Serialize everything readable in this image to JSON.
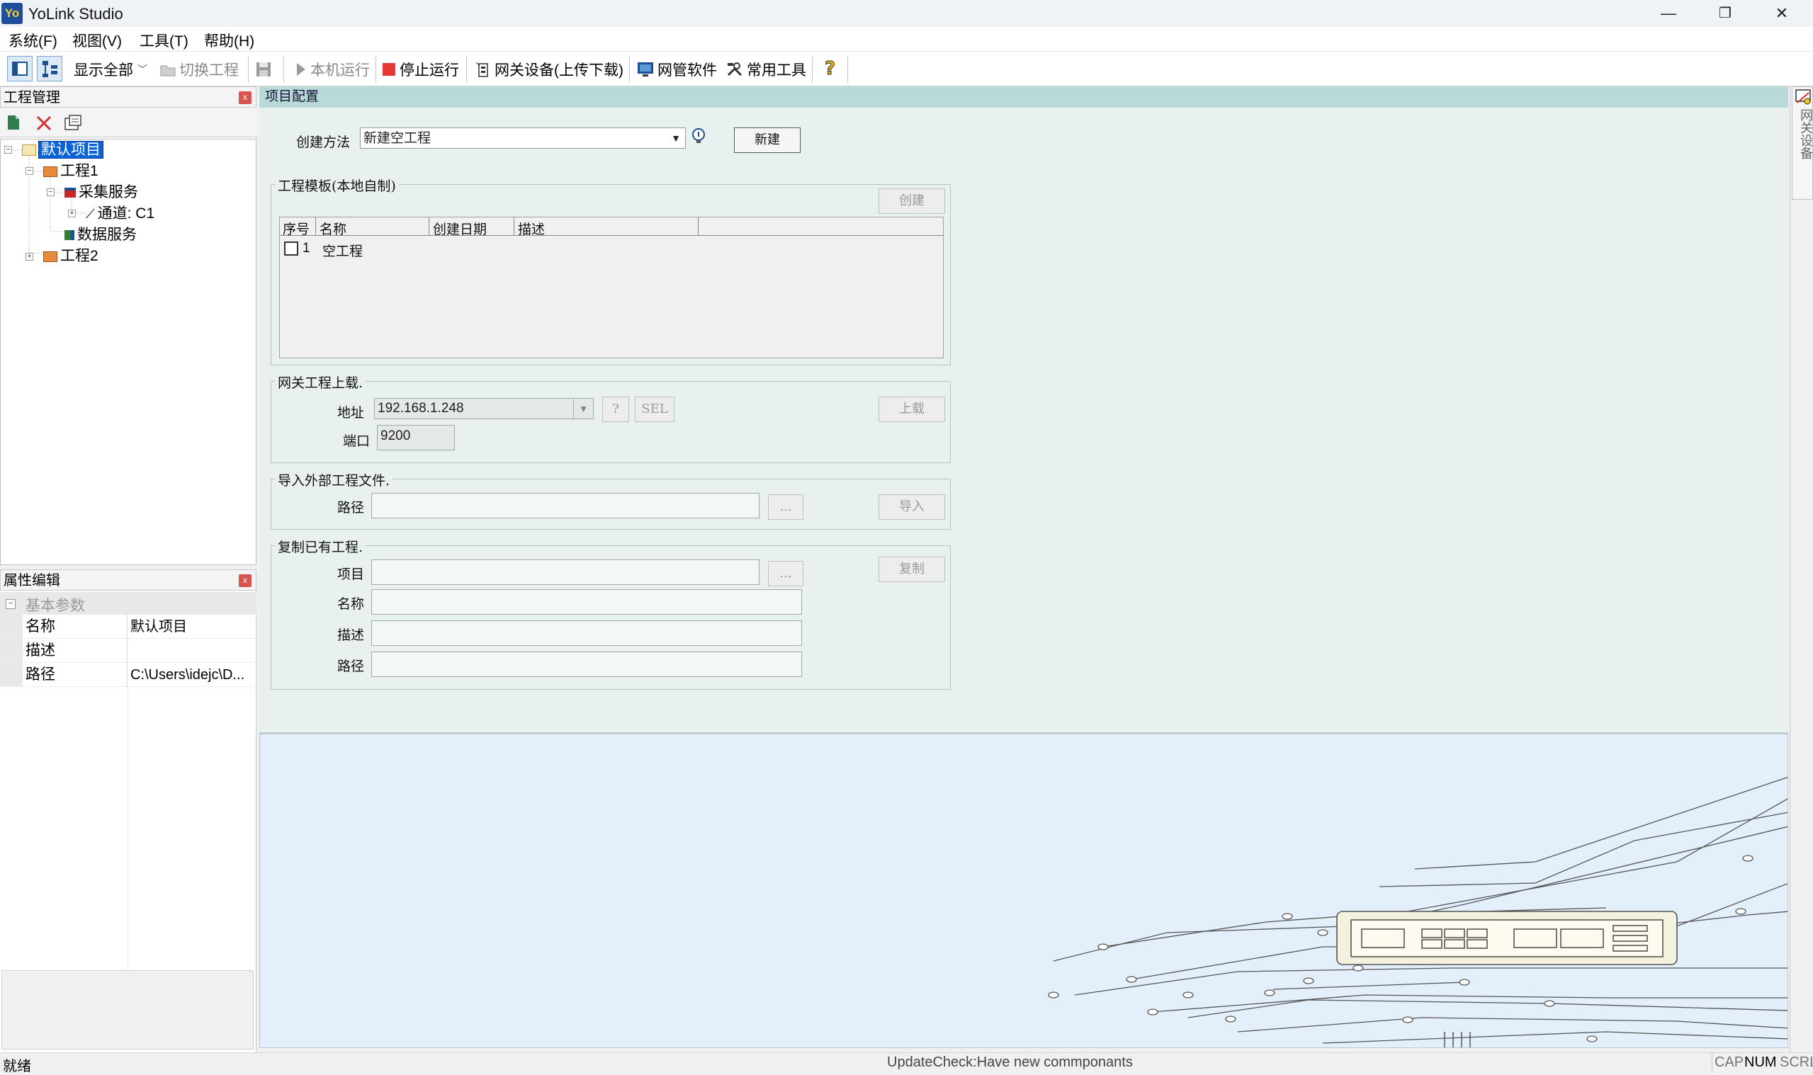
{
  "window": {
    "logo": "Yo",
    "title": "YoLink Studio",
    "minimize": "—",
    "restore": "❐",
    "close": "✕"
  },
  "menu": [
    "系统(F)",
    "视图(V)",
    "工具(T)",
    "帮助(H)"
  ],
  "toolbar": {
    "show_all": "显示全部",
    "switch_project": "切换工程",
    "run_local": "本机运行",
    "stop_run": "停止运行",
    "gateway_device": "网关设备(上传下载)",
    "net_software": "网管软件",
    "common_tools": "常用工具",
    "help_icon": "?"
  },
  "project_panel": {
    "title": "工程管理",
    "tree": {
      "root": "默认项目",
      "project1": "工程1",
      "collect_service": "采集服务",
      "channel": "通道: C1",
      "data_service": "数据服务",
      "project2": "工程2"
    }
  },
  "property_panel": {
    "title": "属性编辑",
    "category": "基本参数",
    "rows": [
      {
        "name": "名称",
        "value": "默认项目"
      },
      {
        "name": "描述",
        "value": ""
      },
      {
        "name": "路径",
        "value": "C:\\Users\\idejc\\D..."
      }
    ]
  },
  "main": {
    "tab_title": "项目配置",
    "create_method_label": "创建方法",
    "create_method_value": "新建空工程",
    "new_button": "新建",
    "template_group": {
      "title": "工程模板(本地自制)",
      "create_button": "创建",
      "columns": [
        "序号",
        "名称",
        "创建日期",
        "描述"
      ],
      "rows": [
        {
          "index": "1",
          "name": "空工程",
          "date": "",
          "desc": ""
        }
      ]
    },
    "upload_group": {
      "title": "网关工程上载.",
      "address_label": "地址",
      "address_value": "192.168.1.248",
      "help_button": "?",
      "sel_button": "SEL",
      "port_label": "端口",
      "port_value": "9200",
      "upload_button": "上载"
    },
    "import_group": {
      "title": "导入外部工程文件.",
      "path_label": "路径",
      "browse_button": "...",
      "import_button": "导入"
    },
    "copy_group": {
      "title": "复制已有工程.",
      "project_label": "项目",
      "name_label": "名称",
      "desc_label": "描述",
      "path_label": "路径",
      "browse_button": "...",
      "copy_button": "复制"
    }
  },
  "side_tab": "网关设备",
  "status": {
    "left": "就绪",
    "center": "UpdateCheck:Have new commponants",
    "cap": "CAP",
    "num": "NUM",
    "scrl": "SCRL"
  }
}
